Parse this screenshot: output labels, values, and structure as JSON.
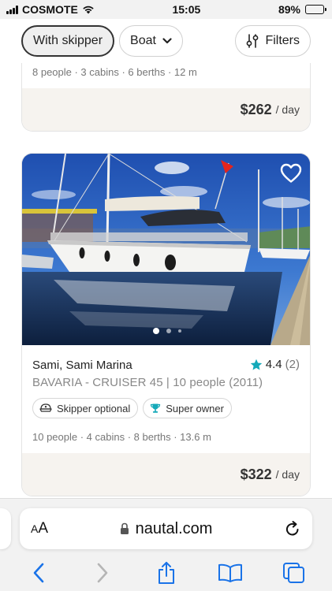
{
  "status_bar": {
    "carrier": "COSMOTE",
    "time": "15:05",
    "battery": "89%",
    "battery_level": 0.89
  },
  "filters": {
    "skipper_label": "With skipper",
    "boat_label": "Boat",
    "filters_label": "Filters"
  },
  "listing_1": {
    "specs": "8 people · 3 cabins · 6 berths · 12 m",
    "price": "$262",
    "per": "/ day"
  },
  "listing_2": {
    "location": "Sami, Sami Marina",
    "rating": "4.4",
    "reviews": "(2)",
    "model": "BAVARIA - CRUISER 45 | 10 people (2011)",
    "badges": [
      "Skipper optional",
      "Super owner"
    ],
    "specs": "10 people · 4 cabins · 8 berths · 13.6 m",
    "price": "$322",
    "per": "/ day",
    "photo_count_shown": 3,
    "active_photo": 1
  },
  "browser": {
    "aa_large": "A",
    "aa_small": "A",
    "url": "nautal.com"
  },
  "colors": {
    "accent_blue": "#1a73e8",
    "star_teal": "#14a9b9",
    "price_band": "#f6f3ef"
  },
  "icons": {
    "heart": "heart-outline-icon",
    "star": "star-icon",
    "skipper": "skipper-hat-icon",
    "super_owner": "trophy-icon",
    "lock": "lock-icon",
    "reload": "reload-icon"
  }
}
